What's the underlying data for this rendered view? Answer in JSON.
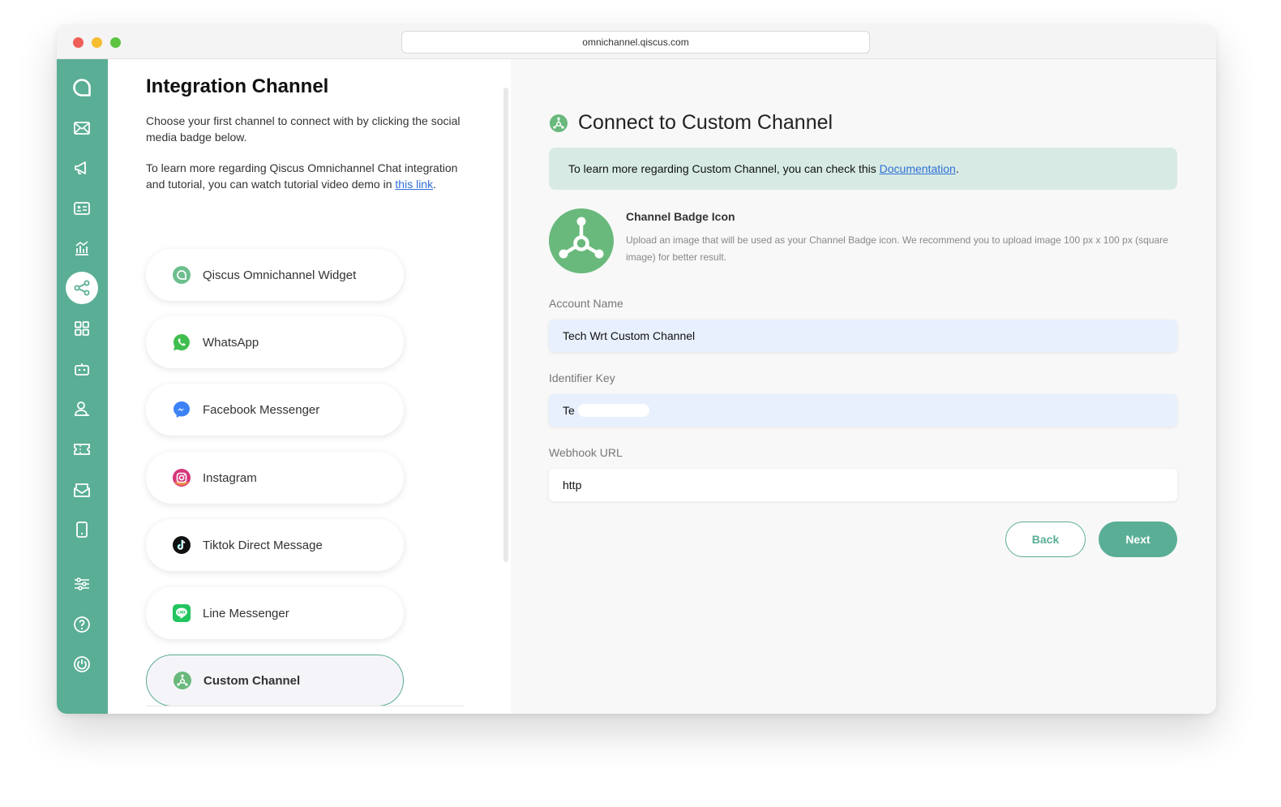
{
  "browser": {
    "url": "omnichannel.qiscus.com"
  },
  "sidebar": {
    "icons": [
      "qiscus-logo-icon",
      "inbox-icon",
      "broadcast-icon",
      "contacts-icon",
      "analytics-icon",
      "integration-icon",
      "apps-icon",
      "bot-icon",
      "agent-icon",
      "ticket-icon",
      "mail-icon",
      "mobile-icon",
      "settings-icon",
      "help-icon",
      "logout-icon"
    ],
    "active": "integration-icon"
  },
  "left": {
    "title": "Integration Channel",
    "intro": "Choose your first channel to connect with by clicking the social media badge below.",
    "learn_prefix": "To learn more regarding Qiscus Omnichannel Chat integration and tutorial, you can watch tutorial video demo in ",
    "learn_link": "this link",
    "learn_suffix": ".",
    "channels": [
      {
        "label": "Qiscus Omnichannel Widget",
        "icon": "qiscus-widget-icon"
      },
      {
        "label": "WhatsApp",
        "icon": "whatsapp-icon"
      },
      {
        "label": "Facebook Messenger",
        "icon": "messenger-icon"
      },
      {
        "label": "Instagram",
        "icon": "instagram-icon"
      },
      {
        "label": "Tiktok Direct Message",
        "icon": "tiktok-icon"
      },
      {
        "label": "Line Messenger",
        "icon": "line-icon"
      },
      {
        "label": "Custom Channel",
        "icon": "custom-channel-icon",
        "selected": true
      }
    ]
  },
  "right": {
    "title": "Connect to Custom Channel",
    "notice_prefix": "To learn more regarding Custom Channel, you can check this ",
    "notice_link": "Documentation",
    "notice_suffix": ".",
    "badge": {
      "title": "Channel Badge Icon",
      "description": "Upload an image that will be used as your Channel Badge icon. We recommend you to upload image 100 px x 100 px (square image) for better result."
    },
    "fields": {
      "account_name": {
        "label": "Account Name",
        "value": "Tech Wrt Custom Channel"
      },
      "identifier_key": {
        "label": "Identifier Key",
        "value": "Te"
      },
      "webhook_url": {
        "label": "Webhook URL",
        "value": "http"
      }
    },
    "buttons": {
      "back": "Back",
      "next": "Next"
    }
  },
  "colors": {
    "brand": "#5aae95",
    "notice_bg": "#d7ebe4",
    "link": "#2f6fd6"
  }
}
